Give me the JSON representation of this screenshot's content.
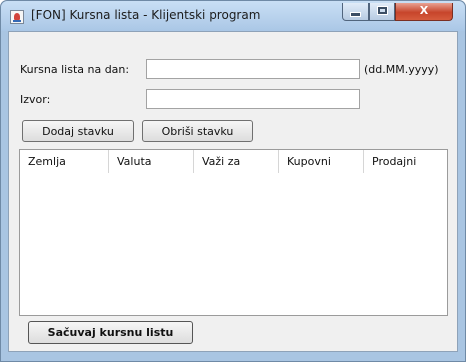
{
  "window": {
    "title": "[FON] Kursna lista - Klijentski program",
    "controls": {
      "minimize": "",
      "maximize": "",
      "close": "X"
    }
  },
  "form": {
    "date_label": "Kursna lista na dan:",
    "date_value": "",
    "date_hint": "(dd.MM.yyyy)",
    "source_label": "Izvor:",
    "source_value": ""
  },
  "buttons": {
    "add": "Dodaj stavku",
    "delete": "Obriši stavku",
    "save": "Sačuvaj kursnu listu"
  },
  "table": {
    "columns": [
      "Zemlja",
      "Valuta",
      "Važi za",
      "Kupovni",
      "Prodajni"
    ],
    "rows": []
  }
}
